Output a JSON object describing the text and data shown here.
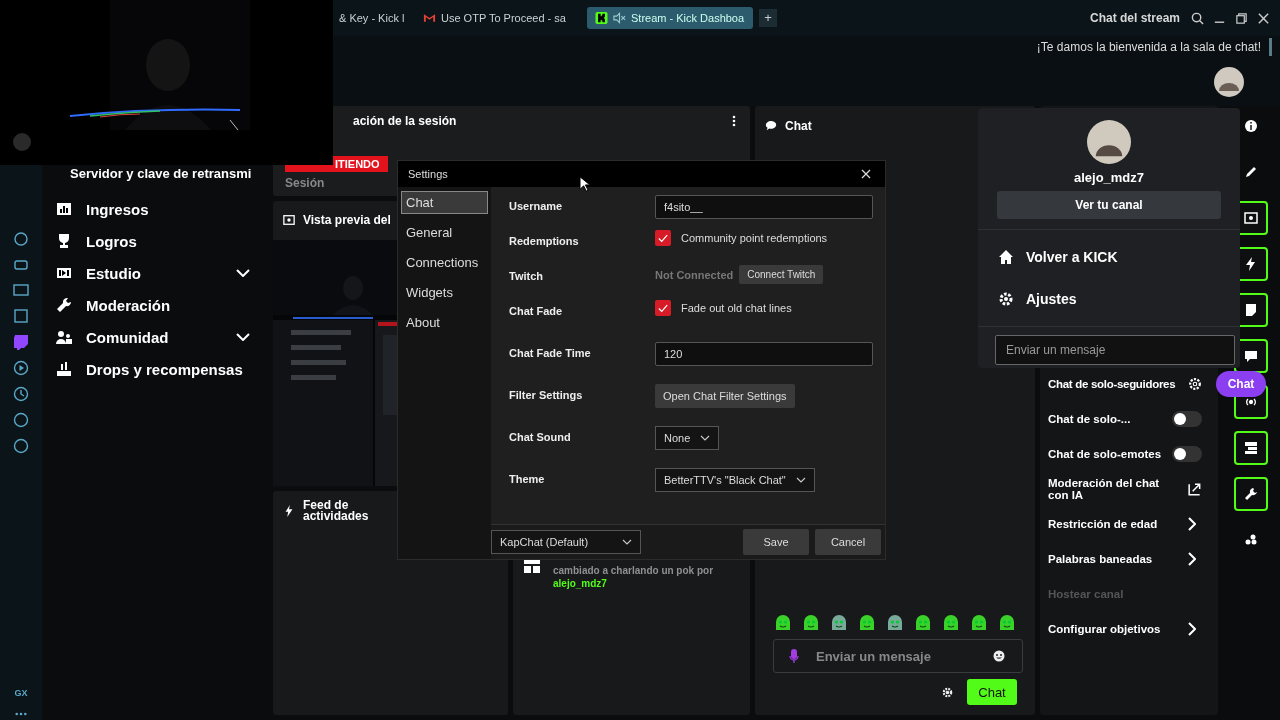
{
  "browser": {
    "tabs": [
      {
        "label": "& Key - Kick l",
        "selected": false
      },
      {
        "label": "Use OTP To Proceed - sa",
        "selected": false
      },
      {
        "label": "Stream - Kick Dashboa",
        "selected": true
      }
    ],
    "new_tab": "+"
  },
  "stream_chat": {
    "title": "Chat del stream",
    "welcome": "¡Te damos la bienvenida a la sala de chat!"
  },
  "left_rail": {
    "footer": "GX"
  },
  "sidebar": {
    "heading": "Servidor y clave de retransmi",
    "items": [
      {
        "label": "Ingresos",
        "kind": "link"
      },
      {
        "label": "Logros",
        "kind": "link"
      },
      {
        "label": "Estudio",
        "kind": "group"
      },
      {
        "label": "Moderación",
        "kind": "link"
      },
      {
        "label": "Comunidad",
        "kind": "group"
      },
      {
        "label": "Drops y recompensas",
        "kind": "link"
      }
    ]
  },
  "session": {
    "title": "ación de la sesión",
    "badge": "ITIENDO",
    "label": "Sesión"
  },
  "preview": {
    "title": "Vista previa del"
  },
  "feed": {
    "title": "Feed de actividades"
  },
  "activity": {
    "message": "cambiado a **charlando un pok** por",
    "user": "alejo_mdz7"
  },
  "chat": {
    "title": "Chat",
    "placeholder": "Enviar un mensaje",
    "send": "Chat"
  },
  "moderation": {
    "items": [
      {
        "label": "Chat de solo-seguidores",
        "kind": "gear",
        "disabled": false
      },
      {
        "label": "Chat de solo-...",
        "kind": "toggle",
        "on": false,
        "disabled": false
      },
      {
        "label": "Chat de solo-emotes",
        "kind": "toggle",
        "on": false,
        "disabled": false
      },
      {
        "label": "Moderación del chat con IA",
        "kind": "external",
        "disabled": false
      },
      {
        "label": "Restricción de edad",
        "kind": "chevron",
        "disabled": false
      },
      {
        "label": "Palabras baneadas",
        "kind": "chevron",
        "disabled": false
      },
      {
        "label": "Hostear canal",
        "kind": "plain",
        "disabled": true
      },
      {
        "label": "Configurar objetivos",
        "kind": "chevron",
        "disabled": false
      }
    ]
  },
  "right_rail": {
    "buttons": [
      {
        "kind": "plain"
      },
      {
        "kind": "plain"
      },
      {
        "kind": "outlined"
      },
      {
        "kind": "outlined"
      },
      {
        "kind": "outlined"
      },
      {
        "kind": "outlined"
      },
      {
        "kind": "outlined"
      },
      {
        "kind": "outlined"
      },
      {
        "kind": "outlined"
      },
      {
        "kind": "plain"
      }
    ]
  },
  "settings": {
    "title": "Settings",
    "nav": [
      {
        "label": "Chat",
        "selected": true
      },
      {
        "label": "General",
        "selected": false
      },
      {
        "label": "Connections",
        "selected": false
      },
      {
        "label": "Widgets",
        "selected": false
      },
      {
        "label": "About",
        "selected": false
      }
    ],
    "rows": [
      {
        "label": "Username",
        "kind": "text",
        "value": "f4sito__"
      },
      {
        "label": "Redemptions",
        "kind": "checkbox",
        "checked": true,
        "text": "Community point redemptions"
      },
      {
        "label": "Twitch",
        "kind": "connect",
        "status": "Not Connected",
        "button": "Connect Twitch"
      },
      {
        "label": "Chat Fade",
        "kind": "checkbox",
        "checked": true,
        "text": "Fade out old chat lines"
      },
      {
        "label": "Chat Fade Time",
        "kind": "text",
        "value": "120"
      },
      {
        "label": "Filter Settings",
        "kind": "button",
        "button": "Open Chat Filter Settings"
      },
      {
        "label": "Chat Sound",
        "kind": "select",
        "value": "None"
      },
      {
        "label": "Theme",
        "kind": "select",
        "value": "BetterTTV's \"Black Chat\""
      }
    ],
    "preset": "KapChat (Default)",
    "save": "Save",
    "cancel": "Cancel"
  },
  "user_menu": {
    "username": "alejo_mdz7",
    "channel_button": "Ver tu canal",
    "items": [
      {
        "label": "Volver a KICK"
      },
      {
        "label": "Ajustes"
      }
    ],
    "placeholder": "Enviar un mensaje"
  },
  "chat_pill": "Chat"
}
